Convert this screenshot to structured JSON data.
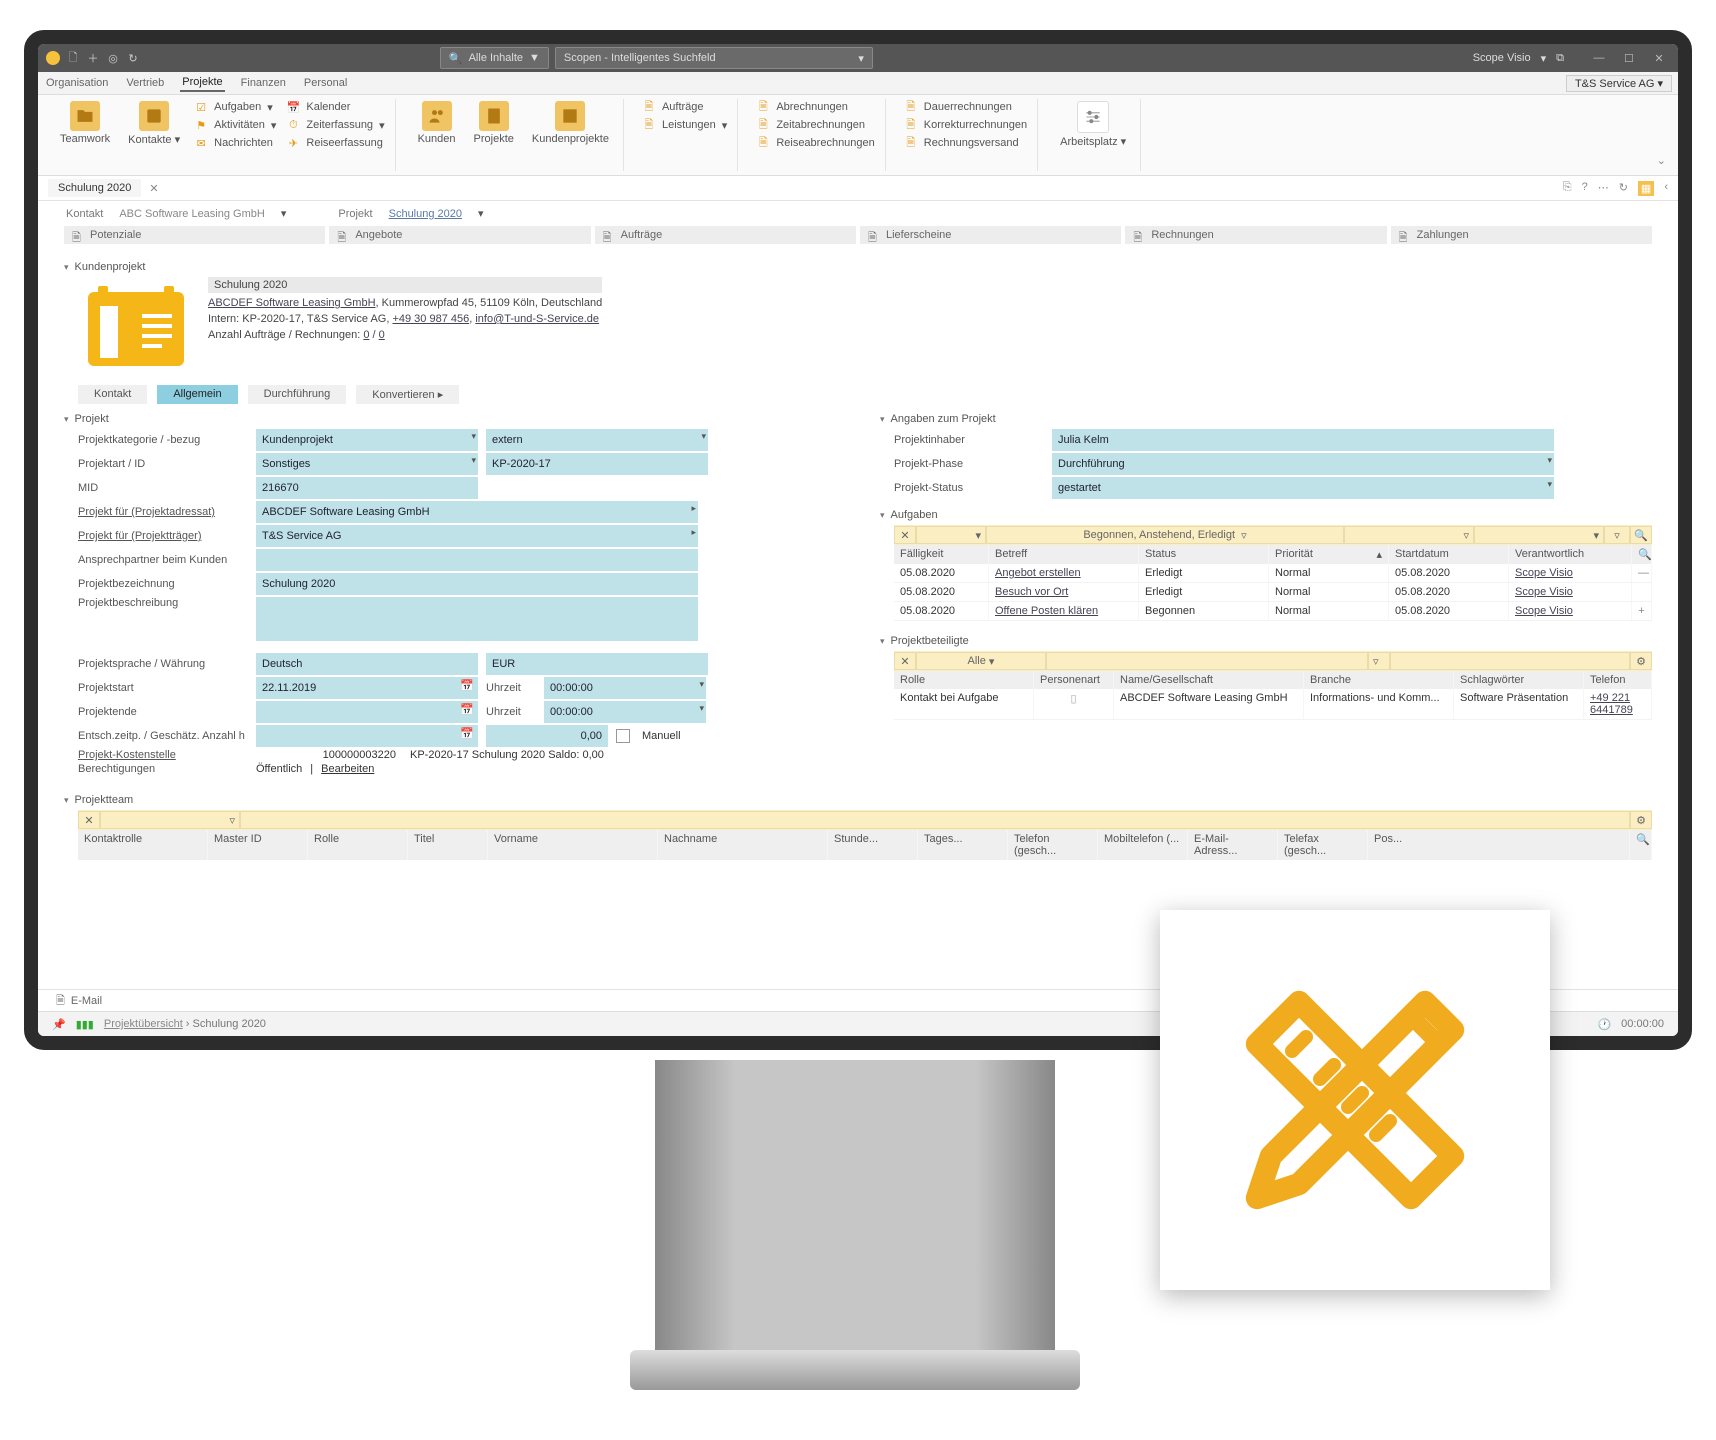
{
  "titlebar": {
    "search_dropdown": "Alle Inhalte",
    "search_placeholder": "Scopen - Intelligentes Suchfeld",
    "product": "Scope Visio"
  },
  "menu": {
    "items": [
      "Organisation",
      "Vertrieb",
      "Projekte",
      "Finanzen",
      "Personal"
    ],
    "active": "Projekte",
    "tenant": "T&S Service AG"
  },
  "ribbon": {
    "big": [
      {
        "label": "Teamwork"
      },
      {
        "label": "Kontakte"
      }
    ],
    "col1": [
      "Aufgaben",
      "Aktivitäten",
      "Nachrichten"
    ],
    "col2": [
      "Kalender",
      "Zeiterfassung",
      "Reiseerfassung"
    ],
    "big2": [
      {
        "label": "Kunden"
      },
      {
        "label": "Projekte"
      },
      {
        "label": "Kundenprojekte"
      }
    ],
    "col3": [
      "Aufträge",
      "Leistungen"
    ],
    "col4": [
      "Abrechnungen",
      "Zeitabrechnungen",
      "Reiseabrechnungen"
    ],
    "col5": [
      "Dauerrechnungen",
      "Korrekturrechnungen",
      "Rechnungsversand"
    ],
    "col6": [
      "Arbeitsplatz"
    ]
  },
  "doctab": {
    "label": "Schulung 2020"
  },
  "context": {
    "kontakt_label": "Kontakt",
    "kontakt_value": "ABC Software Leasing GmbH",
    "projekt_label": "Projekt",
    "projekt_value": "Schulung 2020"
  },
  "navpills": [
    "Potenziale",
    "Angebote",
    "Aufträge",
    "Lieferscheine",
    "Rechnungen",
    "Zahlungen"
  ],
  "header": {
    "section": "Kundenprojekt",
    "title": "Schulung 2020",
    "company_link": "ABCDEF Software Leasing GmbH",
    "address": "Kummerowpfad 45, 51109 Köln, Deutschland",
    "intern_prefix": "Intern: KP-2020-17, T&S Service AG, ",
    "phone": "+49 30 987 456",
    "email": "info@T-und-S-Service.de",
    "counts_prefix": "Anzahl Aufträge / Rechnungen: ",
    "count_a": "0",
    "count_b": "0"
  },
  "minitabs": {
    "items": [
      "Kontakt",
      "Allgemein",
      "Durchführung",
      "Konvertieren ▸"
    ],
    "active": "Allgemein"
  },
  "projekt": {
    "section": "Projekt",
    "kategorie_l": "Projektkategorie / -bezug",
    "kategorie_v": "Kundenprojekt",
    "kategorie_ext": "extern",
    "art_l": "Projektart / ID",
    "art_v": "Sonstiges",
    "art_id": "KP-2020-17",
    "mid_l": "MID",
    "mid_v": "216670",
    "adressat_l": "Projekt für (Projektadressat)",
    "adressat_v": "ABCDEF Software Leasing GmbH",
    "traeger_l": "Projekt für (Projektträger)",
    "traeger_v": "T&S Service AG",
    "ansprech_l": "Ansprechpartner beim Kunden",
    "bezeichnung_l": "Projektbezeichnung",
    "bezeichnung_v": "Schulung 2020",
    "beschreibung_l": "Projektbeschreibung",
    "sprache_l": "Projektsprache / Währung",
    "sprache_v": "Deutsch",
    "waehrung_v": "EUR",
    "start_l": "Projektstart",
    "start_v": "22.11.2019",
    "uhr_l": "Uhrzeit",
    "uhr_v": "00:00:00",
    "ende_l": "Projektende",
    "anzahl_l": "Entsch.zeitp. / Geschätz. Anzahl h",
    "anzahl_v": "0,00",
    "manuell": "Manuell",
    "kst_l": "Projekt-Kostenstelle",
    "kst_num": "100000003220",
    "kst_txt": "KP-2020-17 Schulung 2020 Saldo: 0,00",
    "perm_l": "Berechtigungen",
    "perm_v": "Öffentlich",
    "perm_edit": "Bearbeiten"
  },
  "angaben": {
    "section": "Angaben zum Projekt",
    "inhaber_l": "Projektinhaber",
    "inhaber_v": "Julia Kelm",
    "phase_l": "Projekt-Phase",
    "phase_v": "Durchführung",
    "status_l": "Projekt-Status",
    "status_v": "gestartet"
  },
  "aufgaben": {
    "section": "Aufgaben",
    "filter": "Begonnen, Anstehend, Erledigt",
    "headers": [
      "Fälligkeit",
      "Betreff",
      "Status",
      "Priorität",
      "Startdatum",
      "Verantwortlich"
    ],
    "rows": [
      {
        "f": "05.08.2020",
        "b": "Angebot erstellen",
        "s": "Erledigt",
        "p": "Normal",
        "d": "05.08.2020",
        "v": "Scope Visio"
      },
      {
        "f": "05.08.2020",
        "b": "Besuch vor Ort",
        "s": "Erledigt",
        "p": "Normal",
        "d": "05.08.2020",
        "v": "Scope Visio"
      },
      {
        "f": "05.08.2020",
        "b": "Offene Posten klären",
        "s": "Begonnen",
        "p": "Normal",
        "d": "05.08.2020",
        "v": "Scope Visio"
      }
    ]
  },
  "beteiligte": {
    "section": "Projektbeteiligte",
    "filter": "Alle",
    "headers": [
      "Rolle",
      "Personenart",
      "Name/Gesellschaft",
      "Branche",
      "Schlagwörter",
      "Telefon"
    ],
    "rows": [
      {
        "r": "Kontakt bei Aufgabe",
        "p": "",
        "n": "ABCDEF Software Leasing GmbH",
        "b": "Informations- und Komm...",
        "s": "Software Präsentation",
        "t": "+49 221 6441789"
      }
    ]
  },
  "team": {
    "section": "Projektteam",
    "headers": [
      "Kontaktrolle",
      "Master ID",
      "Rolle",
      "Titel",
      "Vorname",
      "Nachname",
      "Stunde...",
      "Tages...",
      "Telefon (gesch...",
      "Mobiltelefon (...",
      "E-Mail-Adress...",
      "Telefax (gesch...",
      "Pos..."
    ]
  },
  "email": {
    "label": "E-Mail"
  },
  "footer": {
    "overview": "Projektübersicht",
    "current": "Schulung 2020",
    "time": "00:00:00"
  }
}
